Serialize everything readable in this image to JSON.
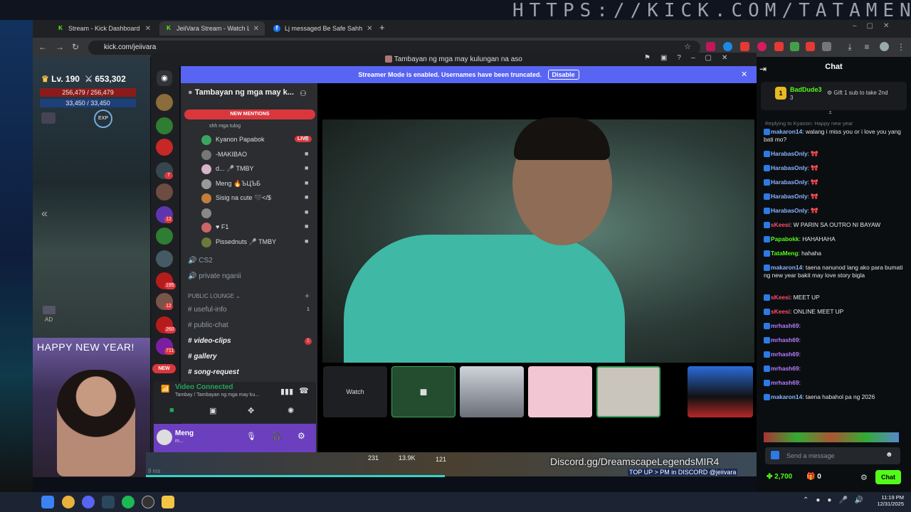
{
  "bg_url_text": "HTTPS://KICK.COM/TATAMENG",
  "browser": {
    "tabs": [
      {
        "label": "Stream - Kick Dashboard",
        "fav": "K",
        "color": "#53fc18"
      },
      {
        "label": "JeiiVara Stream - Watch Live on",
        "fav": "K",
        "color": "#53fc18"
      },
      {
        "label": "Lj messaged Be Safe Sahh",
        "fav": "f",
        "color": "#1877f2"
      }
    ],
    "new_tab": "+",
    "url": "kick.com/jeiivara"
  },
  "game": {
    "level": "Lv. 190",
    "power": "653,302",
    "hp": "256,479 / 256,479",
    "mp": "33,450 / 33,450",
    "exp": "EXP",
    "ad": "AD",
    "bottom_nums": [
      "231",
      "13.9K",
      "121"
    ],
    "ms": "9 ms"
  },
  "webcam": {
    "text": "HAPPY NEW YEAR!"
  },
  "discord": {
    "window_title": "Tambayan ng mga may kulungan na aso",
    "banner": "Streamer Mode is enabled. Usernames have been truncated.",
    "banner_btn": "Disable",
    "server_name": "Tambayan ng mga may k...",
    "new_mentions": "NEW MENTIONS",
    "status_line": "shh mga tulog",
    "voice_users": [
      {
        "name": "Kyanon Papabok",
        "tag": "LIVE"
      },
      {
        "name": "-MAKIBAO",
        "tag": ""
      },
      {
        "name": "d... 🎤 TMBY",
        "tag": ""
      },
      {
        "name": "Meng 🔥ЪЦЪБ",
        "tag": ""
      },
      {
        "name": "Sisig na cute 🖤</$",
        "tag": ""
      },
      {
        "name": "",
        "tag": ""
      },
      {
        "name": "♥ F1",
        "tag": ""
      },
      {
        "name": "Pissednuts 🎤 TMBY",
        "tag": ""
      }
    ],
    "voice_channels": [
      "CS2",
      "private nganii"
    ],
    "category": "PUBLIC LOUNGE",
    "channels": [
      {
        "name": "useful-info",
        "badge": "1",
        "bold": false
      },
      {
        "name": "public-chat",
        "badge": "",
        "bold": false
      },
      {
        "name": "video-clips",
        "badge": "1",
        "bold": true
      },
      {
        "name": "gallery",
        "badge": "",
        "bold": true
      },
      {
        "name": "song-request",
        "badge": "",
        "bold": true
      }
    ],
    "rail_badges": [
      "7",
      "12",
      "195",
      "12",
      "260",
      "711"
    ],
    "new_badge": "NEW",
    "voice_connected": "Video Connected",
    "voice_sub": "Tambay / Tambayan ng mga may ku...",
    "username": "Meng",
    "user_status": "m...",
    "watch_label": "Watch"
  },
  "overlay": {
    "discord_link": "Discord.gg/DreamscapeLegendsMIR4",
    "topup": "TOP UP > PM in DISCORD @jeiivara"
  },
  "chat": {
    "title": "Chat",
    "pinned_user": "BadDude3",
    "pinned_count": "3",
    "pinned_text": "Gift 1 sub to take 2nd",
    "reply_to": "Replying to Kyanon: Happy new year",
    "messages": [
      {
        "user": "makaron14",
        "text": ": walang i miss you or i love you yang bati mo?",
        "color": "#8ab4ff"
      },
      {
        "user": "HarabasOnly",
        "text": ": 🎀",
        "color": "#8ab4ff"
      },
      {
        "user": "HarabasOnly",
        "text": ": 🎀",
        "color": "#8ab4ff"
      },
      {
        "user": "HarabasOnly",
        "text": ": 🎀",
        "color": "#8ab4ff"
      },
      {
        "user": "HarabasOnly",
        "text": ": 🎀",
        "color": "#8ab4ff"
      },
      {
        "user": "HarabasOnly",
        "text": ": 🎀",
        "color": "#8ab4ff"
      },
      {
        "user": "sKeesi",
        "text": ": W PARIN SA OUTRO NI BAYAW",
        "color": "#ff4d6d"
      },
      {
        "user": "Papabokk",
        "text": ": HAHAHAHA",
        "color": "#53fc18"
      },
      {
        "user": "TataMeng",
        "text": ": hahaha",
        "color": "#53fc18"
      },
      {
        "user": "makaron14",
        "text": ": taena nanunod lang ako para bumati ng new year bakit may love story bigla",
        "color": "#8ab4ff"
      },
      {
        "user": "sKeesi",
        "text": ": MEET UP",
        "color": "#ff4d6d"
      },
      {
        "user": "sKeesi",
        "text": ": ONLINE MEET UP",
        "color": "#ff4d6d"
      },
      {
        "user": "mrhash69",
        "text": ":",
        "color": "#b47cff"
      },
      {
        "user": "mrhash69",
        "text": ":",
        "color": "#b47cff"
      },
      {
        "user": "mrhash69",
        "text": ":",
        "color": "#b47cff"
      },
      {
        "user": "mrhash69",
        "text": ":",
        "color": "#b47cff"
      },
      {
        "user": "mrhash69",
        "text": ":",
        "color": "#b47cff"
      },
      {
        "user": "makaron14",
        "text": ": taena habahol pa ng 2026",
        "color": "#8ab4ff"
      }
    ],
    "input_placeholder": "Send a message",
    "points": "2,700",
    "gifts": "0",
    "send_label": "Chat"
  },
  "taskbar": {
    "time": "11:19 PM",
    "date": "12/31/2025"
  },
  "colors": {
    "kick_green": "#53fc18",
    "discord_blurple": "#5865f2",
    "discord_bg": "#2b2d31"
  }
}
